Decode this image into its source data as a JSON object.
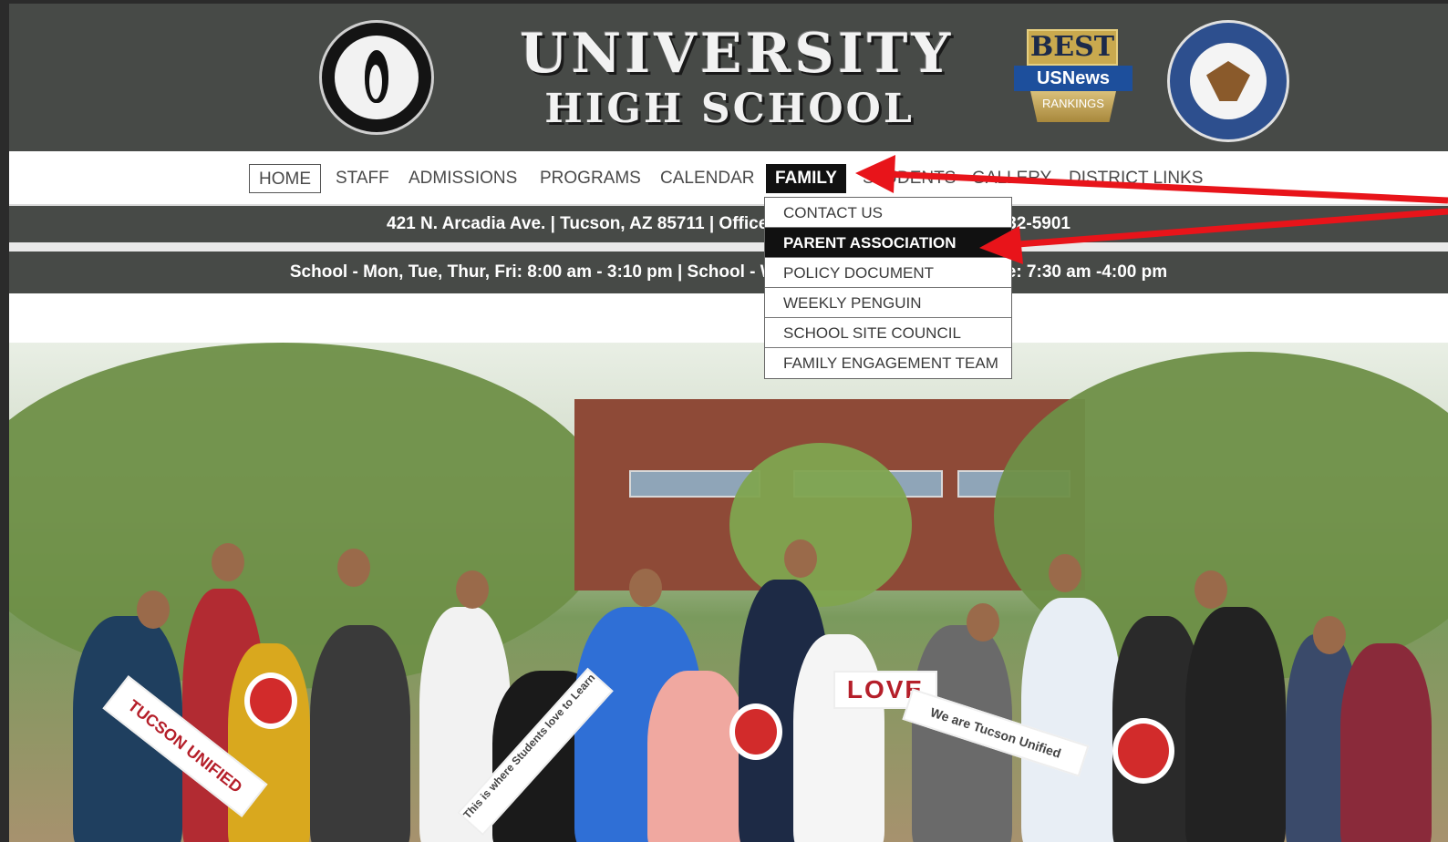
{
  "header": {
    "title_line1": "UNIVERSITY",
    "title_line2": "HIGH SCHOOL",
    "badge": {
      "top": "BEST",
      "middle": "USNews",
      "bottom": "RANKINGS"
    }
  },
  "nav": {
    "items": [
      {
        "label": "HOME"
      },
      {
        "label": "STAFF"
      },
      {
        "label": "ADMISSIONS"
      },
      {
        "label": "PROGRAMS"
      },
      {
        "label": "CALENDAR"
      },
      {
        "label": "FAMILY"
      },
      {
        "label": "STUDENTS"
      },
      {
        "label": "GALLERY"
      },
      {
        "label": "DISTRICT LINKS"
      }
    ]
  },
  "dropdown": {
    "items": [
      {
        "label": "CONTACT US"
      },
      {
        "label": "PARENT ASSOCIATION"
      },
      {
        "label": "POLICY DOCUMENT"
      },
      {
        "label": "WEEKLY PENGUIN"
      },
      {
        "label": "SCHOOL SITE COUNCIL"
      },
      {
        "label": "FAMILY ENGAGEMENT TEAM"
      }
    ]
  },
  "info": {
    "address_line": "421 N. Arcadia Ave.   |   Tucson, AZ 85711   |   Office: (520) 232-5900   |   Fax: (520) 232-5901",
    "hours_line": "School - Mon, Tue, Thur, Fri: 8:00 am - 3:10 pm   |   School - Wed: 8:00 am - 2:10 pm   |   Office: 7:30 am -4:00 pm"
  },
  "hero": {
    "signs": [
      "TUCSON UNIFIED",
      "LOVE",
      "We are Tucson Unified",
      "This is where Students love to Learn"
    ]
  },
  "colors": {
    "header_bg": "#474a47",
    "active_bg": "#111111",
    "annotation_arrow": "#e8141a"
  }
}
